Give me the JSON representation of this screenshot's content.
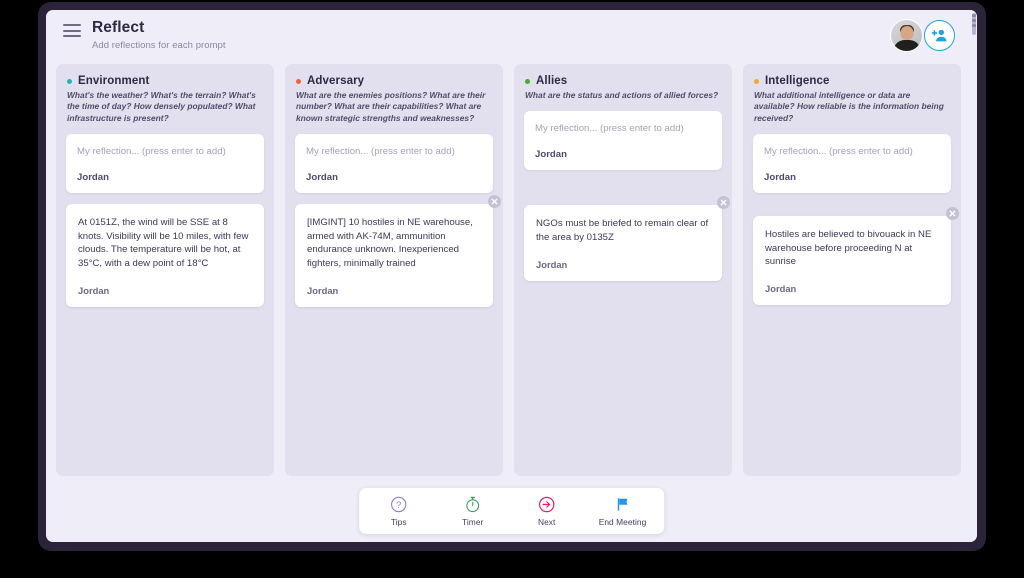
{
  "header": {
    "menu_icon": "hamburger-menu-icon",
    "title": "Reflect",
    "subtitle": "Add reflections for each prompt",
    "avatar_name": "user-avatar",
    "add_person_label": "add-person-icon"
  },
  "scrollbar": {
    "present": true
  },
  "columns": [
    {
      "id": "environment",
      "dot_color": "#22b8b0",
      "title": "Environment",
      "prompt": "What's the weather? What's the terrain? What's the time of day? How densely populated? What infrastructure is present?",
      "input": {
        "placeholder": "My reflection... (press enter to add)",
        "author": "Jordan"
      },
      "cards": [
        {
          "text": "At 0151Z, the wind will be SSE at 8 knots. Visibility will be 10 miles, with few clouds. The temperature will be hot, at 35°C, with a dew point of 18°C",
          "author": "Jordan",
          "stacked": true,
          "has_close": false
        }
      ]
    },
    {
      "id": "adversary",
      "dot_color": "#f4623a",
      "title": "Adversary",
      "prompt": "What are the enemies positions? What are their number? What are their capabilities? What are known strategic strengths and weaknesses?",
      "input": {
        "placeholder": "My reflection... (press enter to add)",
        "author": "Jordan"
      },
      "cards": [
        {
          "text": "[IMGINT] 10 hostiles in NE warehouse, armed with AK-74M, ammunition endurance unknown. Inexperienced fighters, minimally trained",
          "author": "Jordan",
          "stacked": false,
          "has_close": true
        }
      ]
    },
    {
      "id": "allies",
      "dot_color": "#4aa832",
      "title": "Allies",
      "prompt": "What are the status and actions of allied forces?",
      "input": {
        "placeholder": "My reflection... (press enter to add)",
        "author": "Jordan"
      },
      "cards": [
        {
          "text": "NGOs must be briefed to remain clear of the area by 0135Z",
          "author": "Jordan",
          "stacked": false,
          "has_close": true
        }
      ]
    },
    {
      "id": "intelligence",
      "dot_color": "#f0a830",
      "title": "Intelligence",
      "prompt": "What additional intelligence or data are available? How reliable is the information being received?",
      "input": {
        "placeholder": "My reflection... (press enter to add)",
        "author": "Jordan"
      },
      "cards": [
        {
          "text": "Hostiles are believed to bivouack in NE warehouse before proceeding N at sunrise",
          "author": "Jordan",
          "stacked": false,
          "has_close": true
        }
      ]
    }
  ],
  "toolbar": [
    {
      "icon": "question-mark-circle-icon",
      "label": "Tips",
      "color": "#8b7fd4"
    },
    {
      "icon": "stopwatch-icon",
      "label": "Timer",
      "color": "#3da35d"
    },
    {
      "icon": "arrow-right-circle-icon",
      "label": "Next",
      "color": "#ea1a6b"
    },
    {
      "icon": "flag-icon",
      "label": "End Meeting",
      "color": "#2196f3"
    }
  ]
}
